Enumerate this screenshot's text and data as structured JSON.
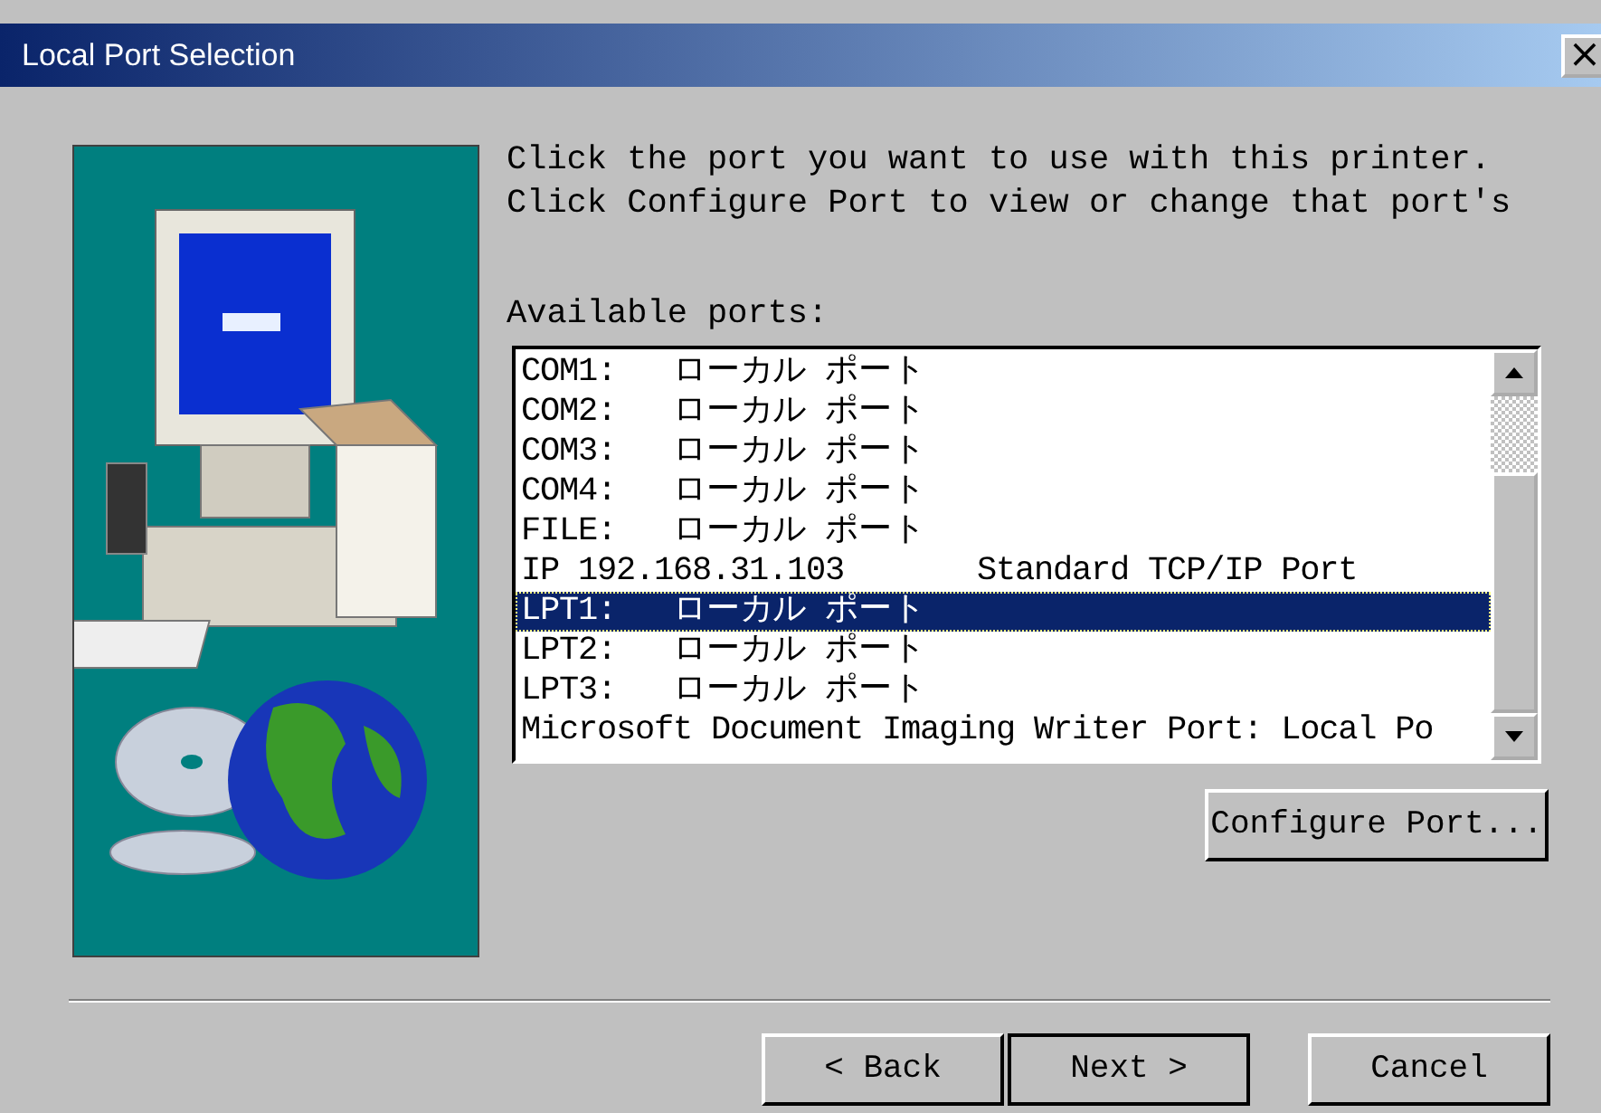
{
  "window": {
    "title": "Local Port Selection",
    "close_glyph": "×"
  },
  "instructions": [
    "Click the port you want to use with this printer.",
    "Click Configure Port to view or change that port's"
  ],
  "ports_label": "Available ports:",
  "ports": [
    {
      "text": "COM1:   ローカル ポート",
      "selected": false
    },
    {
      "text": "COM2:   ローカル ポート",
      "selected": false
    },
    {
      "text": "COM3:   ローカル ポート",
      "selected": false
    },
    {
      "text": "COM4:   ローカル ポート",
      "selected": false
    },
    {
      "text": "FILE:   ローカル ポート",
      "selected": false
    },
    {
      "text": "IP 192.168.31.103       Standard TCP/IP Port",
      "selected": false
    },
    {
      "text": "LPT1:   ローカル ポート",
      "selected": true
    },
    {
      "text": "LPT2:   ローカル ポート",
      "selected": false
    },
    {
      "text": "LPT3:   ローカル ポート",
      "selected": false
    },
    {
      "text": "Microsoft Document Imaging Writer Port: Local Po",
      "selected": false
    }
  ],
  "configure_button": "Configure Port...",
  "buttons": [
    {
      "label": "< Back",
      "default": false
    },
    {
      "label": "Next >",
      "default": true
    },
    {
      "label": "Cancel",
      "default": false
    }
  ]
}
